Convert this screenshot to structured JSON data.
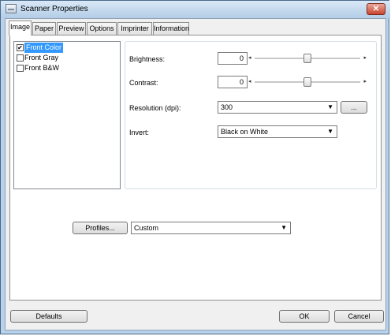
{
  "window": {
    "title": "Scanner Properties",
    "close_glyph": "✕"
  },
  "tabs": [
    {
      "label": "Image",
      "active": true
    },
    {
      "label": "Paper"
    },
    {
      "label": "Preview"
    },
    {
      "label": "Options"
    },
    {
      "label": "Imprinter"
    },
    {
      "label": "Information"
    }
  ],
  "image_types": [
    {
      "label": "Front Color",
      "checked": true,
      "selected": true
    },
    {
      "label": "Front Gray",
      "checked": false
    },
    {
      "label": "Front B&W",
      "checked": false
    }
  ],
  "check_glyph": "✔",
  "brightness": {
    "label": "Brightness:",
    "value": "0",
    "level": 0.5
  },
  "contrast": {
    "label": "Contrast:",
    "value": "0",
    "level": 0.5
  },
  "resolution": {
    "label": "Resolution (dpi):",
    "value": "300",
    "more_button": "..."
  },
  "invert": {
    "label": "Invert:",
    "value": "Black on White"
  },
  "profiles": {
    "button": "Profiles...",
    "value": "Custom"
  },
  "arrows": {
    "left": "◂",
    "right": "▸",
    "down": "▼"
  },
  "footer": {
    "defaults": "Defaults",
    "ok": "OK",
    "cancel": "Cancel"
  }
}
